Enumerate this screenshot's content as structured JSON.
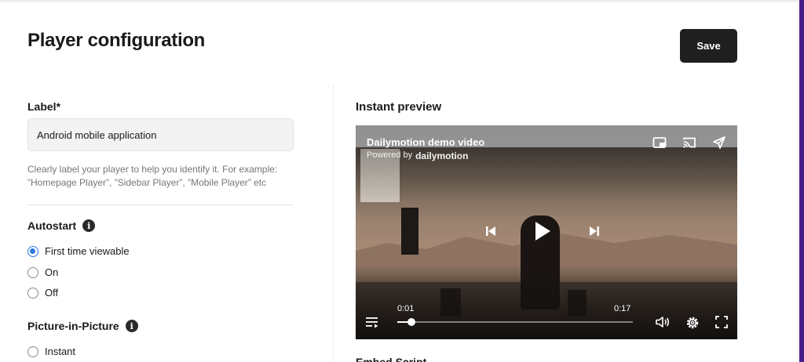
{
  "header": {
    "title": "Player configuration",
    "save_label": "Save"
  },
  "label_field": {
    "label": "Label*",
    "value": "Android mobile application",
    "help": "Clearly label your player to help you identify it. For example: ”Homepage Player”, ”Sidebar Player”, ”Mobile Player” etc"
  },
  "autostart": {
    "title": "Autostart",
    "options": [
      {
        "label": "First time viewable",
        "checked": true
      },
      {
        "label": "On",
        "checked": false
      },
      {
        "label": "Off",
        "checked": false
      }
    ]
  },
  "pip": {
    "title": "Picture-in-Picture",
    "options": [
      {
        "label": "Instant",
        "checked": false
      }
    ]
  },
  "preview": {
    "title": "Instant preview",
    "video_title": "Dailymotion demo video",
    "powered_by": "Powered by",
    "brand": "dailymotion",
    "current_time": "0:01",
    "duration": "0:17",
    "progress_fraction": 0.06
  },
  "embed": {
    "title": "Embed Script"
  },
  "colors": {
    "accent": "#2f7ae5",
    "button": "#1f1f1f"
  }
}
